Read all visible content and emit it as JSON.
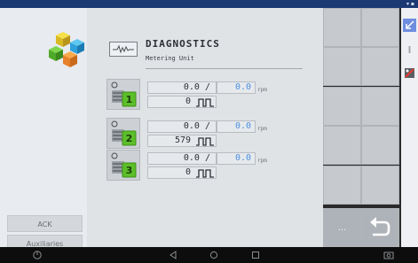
{
  "left": {
    "ack_label": "ACK",
    "auxiliaries_label": "Auxiliaries"
  },
  "header": {
    "title": "DIAGNOSTICS",
    "subtitle": "Metering Unit"
  },
  "units": [
    {
      "number": "1",
      "actual": "0.0 /",
      "target": "0.0",
      "unit": "rpm",
      "pulse_count": "0"
    },
    {
      "number": "2",
      "actual": "0.0 /",
      "target": "0.0",
      "unit": "rpm",
      "pulse_count": "579"
    },
    {
      "number": "3",
      "actual": "0.0 /",
      "target": "0.0",
      "unit": "rpm",
      "pulse_count": "0"
    }
  ],
  "softkeys": {
    "more_label": "...",
    "back_icon": "back-arrow-icon"
  },
  "icons": {
    "logo": "colored-cubes-logo-icon",
    "header": "waveform-icon",
    "pulse": "pulse-wave-icon",
    "tool1": "shrink-arrow-icon",
    "tool2": "vertical-bar-icon",
    "tool3": "tool-error-icon",
    "nav": [
      "power-icon",
      "back-triangle-icon",
      "home-circle-icon",
      "recents-square-icon",
      "camera-icon"
    ]
  },
  "colors": {
    "status_bar": "#1b3a73",
    "target_value": "#4c8fe0",
    "unit_green": "#5cbf2a"
  }
}
